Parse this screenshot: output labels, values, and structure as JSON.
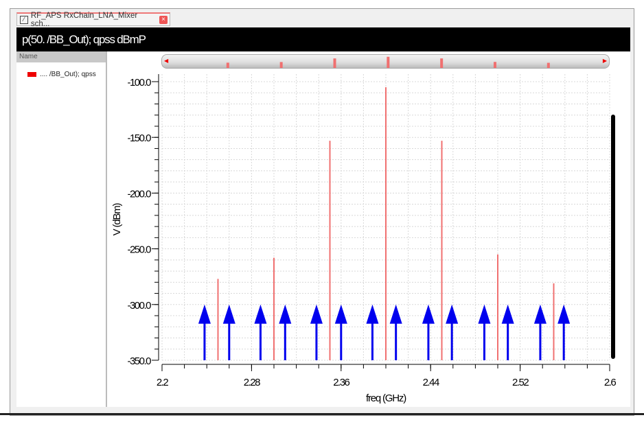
{
  "tab": {
    "label": "RF_APS RxChain_LNA_Mixer sch...",
    "close": "×"
  },
  "title": "p(50. /BB_Out); qpss dBmP",
  "legend": {
    "header": "Name",
    "items": [
      {
        "label": ".... /BB_Out); qpss",
        "color": "#e00000"
      }
    ]
  },
  "chart_data": {
    "type": "bar",
    "title": "p(50. /BB_Out); qpss dBmP",
    "xlabel": "freq (GHz)",
    "ylabel": "V (dBm)",
    "xlim": [
      2.2,
      2.6
    ],
    "ylim": [
      -350,
      -100
    ],
    "xticks": [
      "2.2",
      "2.28",
      "2.36",
      "2.44",
      "2.52",
      "2.6"
    ],
    "yticks": [
      "-100.0",
      "-150.0",
      "-200.0",
      "-250.0",
      "-300.0",
      "-350.0"
    ],
    "grid": true,
    "series": [
      {
        "name": ".... /BB_Out); qpss",
        "color": "#f07070",
        "x": [
          2.25,
          2.3,
          2.35,
          2.4,
          2.45,
          2.5,
          2.55
        ],
        "values": [
          -277,
          -258,
          -153,
          -105,
          -153,
          -255,
          -281
        ]
      }
    ],
    "annotations": {
      "type": "arrows",
      "color": "#0000ee",
      "tip_value": -300,
      "x": [
        2.238,
        2.26,
        2.288,
        2.31,
        2.338,
        2.36,
        2.388,
        2.409,
        2.438,
        2.459,
        2.488,
        2.509,
        2.538,
        2.559
      ]
    }
  }
}
